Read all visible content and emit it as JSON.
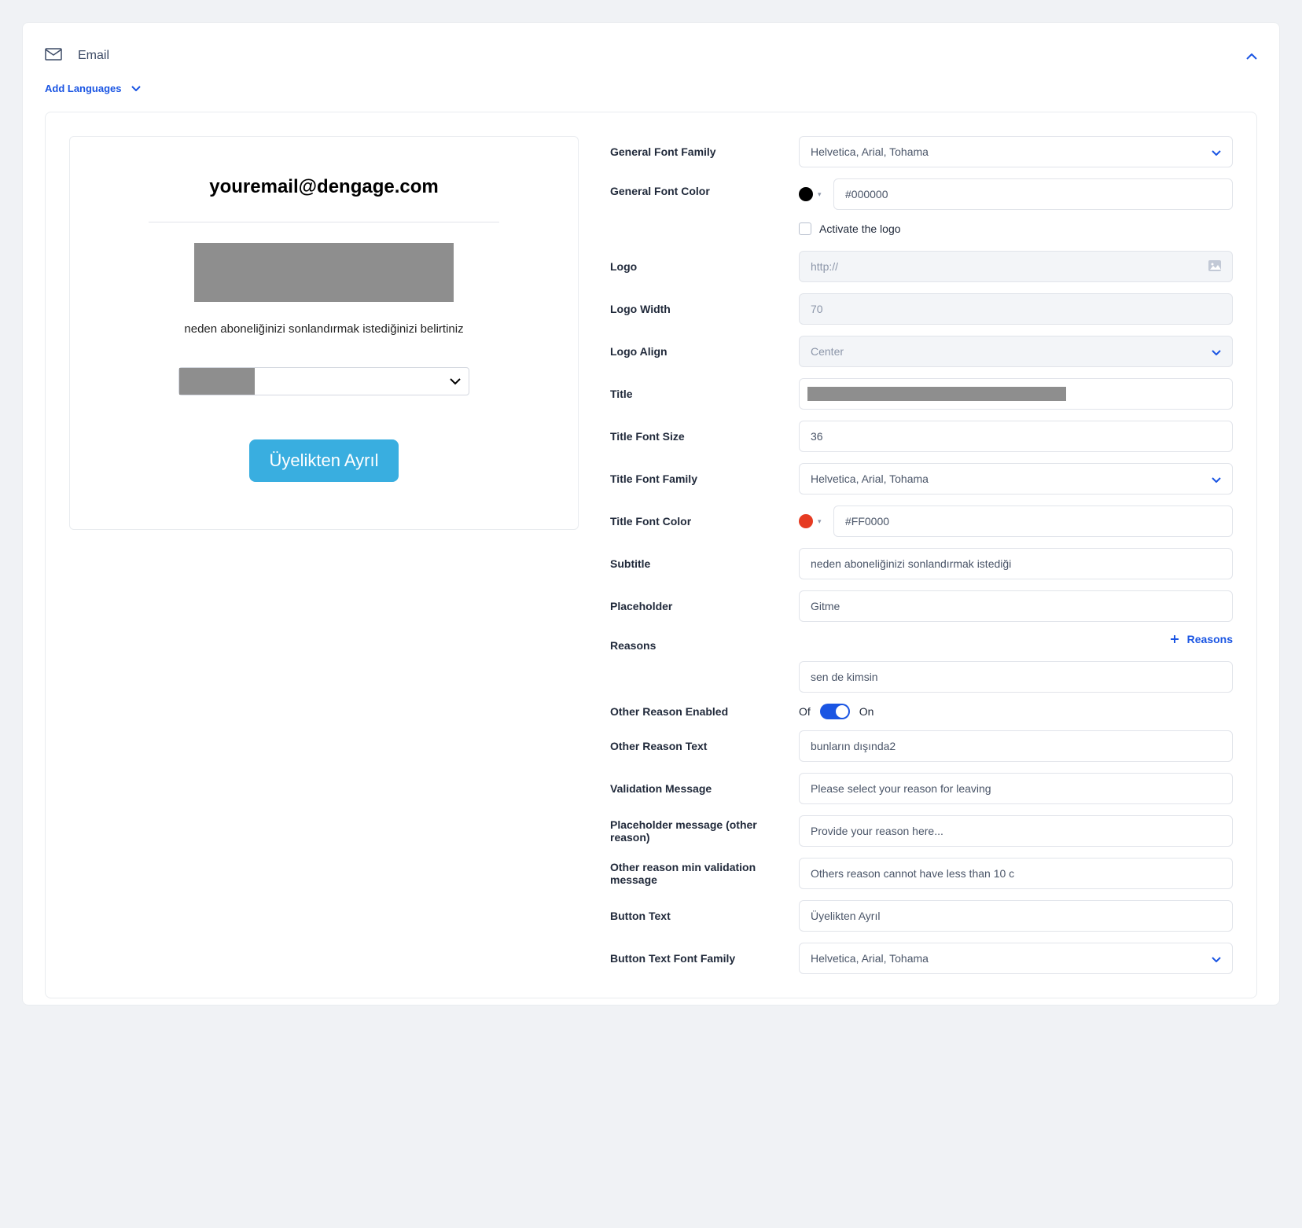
{
  "header": {
    "title": "Email",
    "add_languages": "Add Languages"
  },
  "preview": {
    "email": "youremail@dengage.com",
    "subtitle": "neden aboneliğinizi sonlandırmak istediğinizi belirtiniz",
    "button": "Üyelikten Ayrıl"
  },
  "form": {
    "labels": {
      "general_font_family": "General Font Family",
      "general_font_color": "General Font Color",
      "activate_logo": "Activate the logo",
      "logo": "Logo",
      "logo_width": "Logo Width",
      "logo_align": "Logo Align",
      "title": "Title",
      "title_font_size": "Title Font Size",
      "title_font_family": "Title Font Family",
      "title_font_color": "Title Font Color",
      "subtitle": "Subtitle",
      "placeholder": "Placeholder",
      "reasons": "Reasons",
      "reasons_add": "Reasons",
      "other_reason_enabled": "Other Reason Enabled",
      "other_reason_text": "Other Reason Text",
      "validation_message": "Validation Message",
      "placeholder_other": "Placeholder message (other reason)",
      "other_min_validation": "Other reason min validation message",
      "button_text": "Button Text",
      "button_text_font_family": "Button Text Font Family",
      "toggle_off": "Of",
      "toggle_on": "On"
    },
    "values": {
      "general_font_family": "Helvetica, Arial, Tohama",
      "general_font_color": "#000000",
      "general_font_color_swatch": "#000000",
      "logo_url_placeholder": "http://",
      "logo_width_placeholder": "70",
      "logo_align": "Center",
      "title_font_size": "36",
      "title_font_family": "Helvetica, Arial, Tohama",
      "title_font_color": "#FF0000",
      "title_font_color_swatch": "#e63b22",
      "subtitle": "neden aboneliğinizi sonlandırmak istediği",
      "placeholder": "Gitme",
      "reason_1": "sen de kimsin",
      "other_reason_text": "bunların dışında2",
      "validation_message": "Please select your reason for leaving",
      "placeholder_other": "Provide your reason here...",
      "other_min_validation": "Others reason cannot have less than 10 c",
      "button_text": "Üyelikten Ayrıl",
      "button_text_font_family": "Helvetica, Arial, Tohama"
    }
  }
}
